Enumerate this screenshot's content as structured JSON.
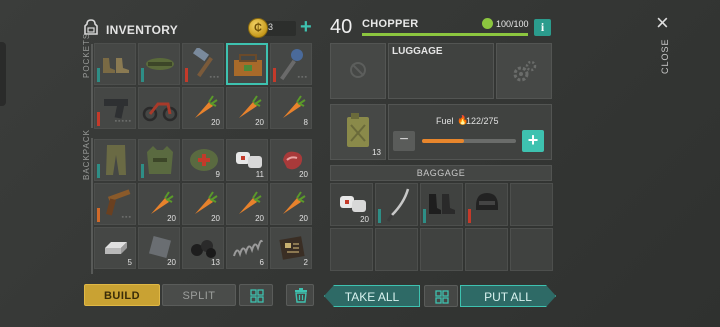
{
  "inventory": {
    "title": "INVENTORY",
    "coins": "3",
    "add_coins": "+",
    "pockets_label": "POCKETS",
    "backpack_label": "BACKPACK",
    "pockets": [
      {
        "item": "boots-icon",
        "qty": ""
      },
      {
        "item": "helmet-camo-icon",
        "qty": ""
      },
      {
        "item": "hammer-icon",
        "qty": ""
      },
      {
        "item": "toolbox-icon",
        "qty": ""
      },
      {
        "item": "mace-icon",
        "qty": ""
      },
      {
        "item": "pistol-icon",
        "qty": ""
      },
      {
        "item": "motorcycle-icon",
        "qty": ""
      },
      {
        "item": "carrot-icon",
        "qty": "20"
      },
      {
        "item": "carrot-icon",
        "qty": "20"
      },
      {
        "item": "carrot-icon",
        "qty": "8"
      }
    ],
    "backpack": [
      {
        "item": "pants-icon",
        "qty": ""
      },
      {
        "item": "vest-icon",
        "qty": ""
      },
      {
        "item": "medic-kit-icon",
        "qty": "9"
      },
      {
        "item": "bandage-icon",
        "qty": "11"
      },
      {
        "item": "raw-meat-icon",
        "qty": "20"
      },
      {
        "item": "rifle-icon",
        "qty": ""
      },
      {
        "item": "carrot-icon",
        "qty": "20"
      },
      {
        "item": "carrot-icon",
        "qty": "20"
      },
      {
        "item": "carrot-icon",
        "qty": "20"
      },
      {
        "item": "carrot-icon",
        "qty": "20"
      },
      {
        "item": "ingot-icon",
        "qty": "5"
      },
      {
        "item": "metal-plate-icon",
        "qty": "20"
      },
      {
        "item": "coal-icon",
        "qty": "13"
      },
      {
        "item": "spring-icon",
        "qty": "6"
      },
      {
        "item": "circuit-icon",
        "qty": "2"
      }
    ]
  },
  "buttons": {
    "build": "BUILD",
    "split": "SPLIT",
    "take_all": "TAKE ALL",
    "put_all": "PUT ALL"
  },
  "vehicle": {
    "level": "40",
    "name": "CHOPPER",
    "hp": "100/100",
    "hp_fraction": 1.0,
    "info": "i",
    "luggage_title": "LUGGAGE",
    "fuel_label": "Fuel",
    "fuel_value": "122/275",
    "fuel_fraction": 0.4436,
    "fuel_can_qty": "13",
    "minus": "−",
    "plus": "+",
    "baggage_title": "BAGGAGE",
    "baggage": [
      {
        "item": "bandage-icon",
        "qty": "20"
      },
      {
        "item": "katana-icon",
        "qty": ""
      },
      {
        "item": "combat-boots-icon",
        "qty": ""
      },
      {
        "item": "tactical-helmet-icon",
        "qty": ""
      },
      {
        "item": "",
        "qty": ""
      },
      {
        "item": "",
        "qty": ""
      },
      {
        "item": "",
        "qty": ""
      },
      {
        "item": "",
        "qty": ""
      },
      {
        "item": "",
        "qty": ""
      },
      {
        "item": "",
        "qty": ""
      }
    ]
  },
  "close": {
    "icon": "×",
    "label": "CLOSE"
  },
  "colors": {
    "accent": "#3ec2b0",
    "build": "#c9a233",
    "hp": "#8cc63f",
    "fuel": "#e8862c"
  }
}
